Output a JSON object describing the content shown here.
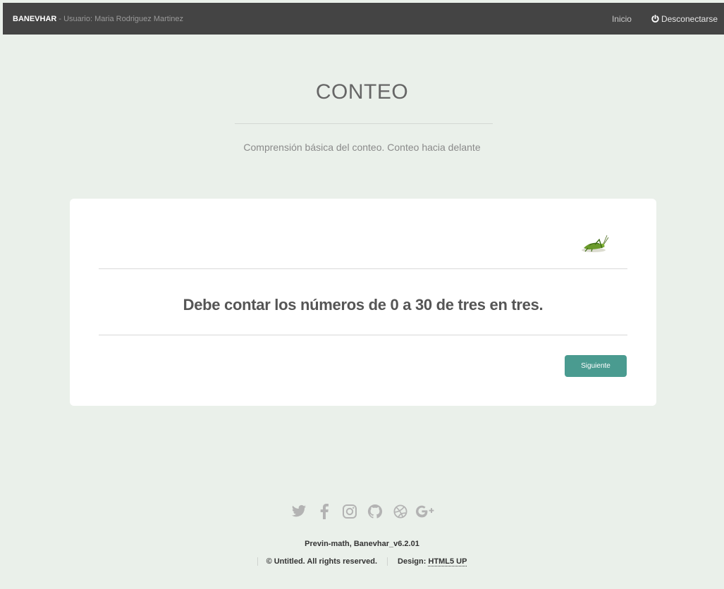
{
  "topbar": {
    "brand": "BANEVHAR",
    "user": "- Usuario: Maria Rodriguez Martinez",
    "nav_home": "Inicio",
    "logout": "Desconectarse"
  },
  "header": {
    "title": "CONTEO",
    "subtitle": "Comprensión básica del conteo. Conteo hacia delante"
  },
  "card": {
    "instruction": "Debe contar los números de 0 a 30 de tres en tres.",
    "next_button": "Siguiente"
  },
  "footer": {
    "social_icons": [
      "twitter-icon",
      "facebook-icon",
      "instagram-icon",
      "github-icon",
      "dribbble-icon",
      "google-plus-icon"
    ],
    "version": "Previn-math, Banevhar_v6.2.01",
    "copyright": "© Untitled. All rights reserved.",
    "design_label": "Design: ",
    "design_link": "HTML5 UP"
  },
  "colors": {
    "topbar": "#444444",
    "background": "#eaf0ea",
    "button": "#4a9b90"
  }
}
